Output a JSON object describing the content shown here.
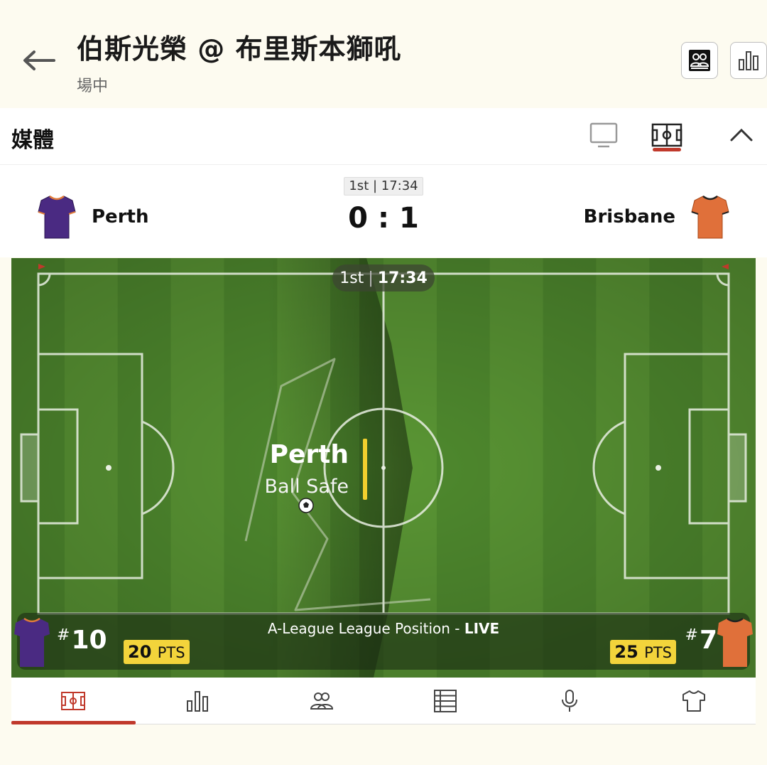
{
  "header": {
    "title": "伯斯光榮 @ 布里斯本獅吼",
    "status": "場中",
    "icons": [
      "back-arrow-icon",
      "lineup-icon",
      "stats-bars-icon"
    ]
  },
  "media": {
    "title": "媒體",
    "icons": [
      "tv-icon",
      "pitch-icon",
      "chevron-up-icon"
    ],
    "accent_color": "#c0392b"
  },
  "scoreboard": {
    "period_label": "1st | 17:34",
    "home": {
      "name": "Perth",
      "score": "0",
      "jersey_color": "#4a2a82"
    },
    "away": {
      "name": "Brisbane",
      "score": "1",
      "jersey_color": "#e0703a"
    },
    "separator": ":"
  },
  "pitch": {
    "clock_period": "1st",
    "clock_sep": "|",
    "clock_time": "17:34",
    "event_team": "Perth",
    "event_desc": "Ball Safe",
    "event_color": "#f2cf2e"
  },
  "league": {
    "title_prefix": "A-League League Position - ",
    "title_live": "LIVE",
    "home": {
      "rank": "10",
      "points": "20",
      "points_unit": "PTS"
    },
    "away": {
      "rank": "7",
      "points": "25",
      "points_unit": "PTS"
    },
    "hash": "#",
    "badge_color": "#f3d43b"
  },
  "tabs": [
    {
      "id": "tracker",
      "icon": "pitch-icon",
      "active": true
    },
    {
      "id": "stats",
      "icon": "bar-chart-icon",
      "active": false
    },
    {
      "id": "lineups",
      "icon": "people-icon",
      "active": false
    },
    {
      "id": "standings",
      "icon": "table-icon",
      "active": false
    },
    {
      "id": "commentary",
      "icon": "microphone-icon",
      "active": false
    },
    {
      "id": "kits",
      "icon": "shirt-icon",
      "active": false
    }
  ]
}
